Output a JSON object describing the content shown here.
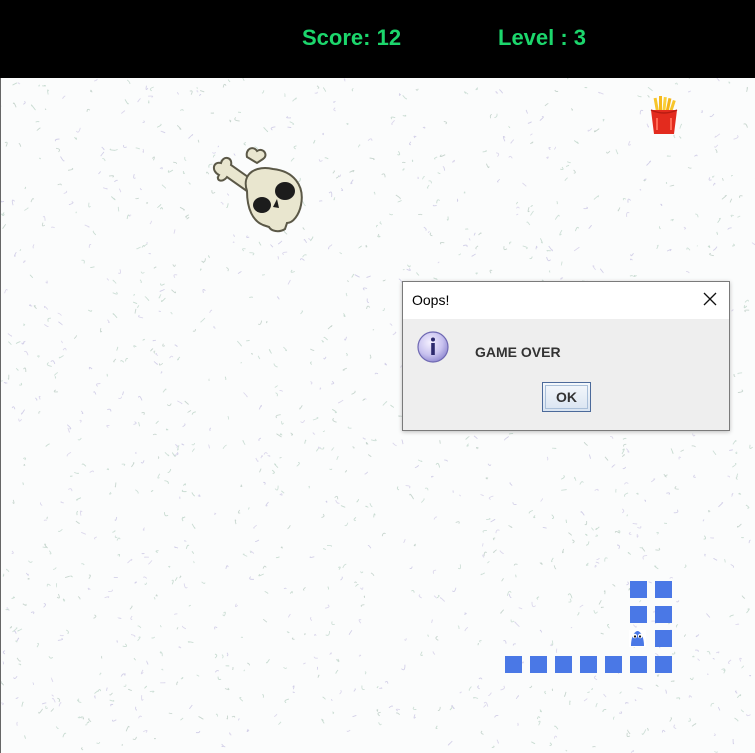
{
  "status_bar": {
    "score_text": "Score: 12",
    "level_text": "Level : 3",
    "text_color": "#1cd66c",
    "background": "#000000"
  },
  "game": {
    "score": 12,
    "level": 3,
    "items": [
      {
        "name": "fries",
        "icon": "fries-icon"
      },
      {
        "name": "skull-and-crossbones",
        "icon": "skull-crossbones-icon"
      }
    ],
    "snake": {
      "color": "#4a78e6",
      "segment_count": 12,
      "head_icon": "snake-head-icon"
    }
  },
  "dialog": {
    "title": "Oops!",
    "message": "GAME OVER",
    "ok_label": "OK",
    "icon": "info-icon",
    "close_icon": "close-icon"
  }
}
